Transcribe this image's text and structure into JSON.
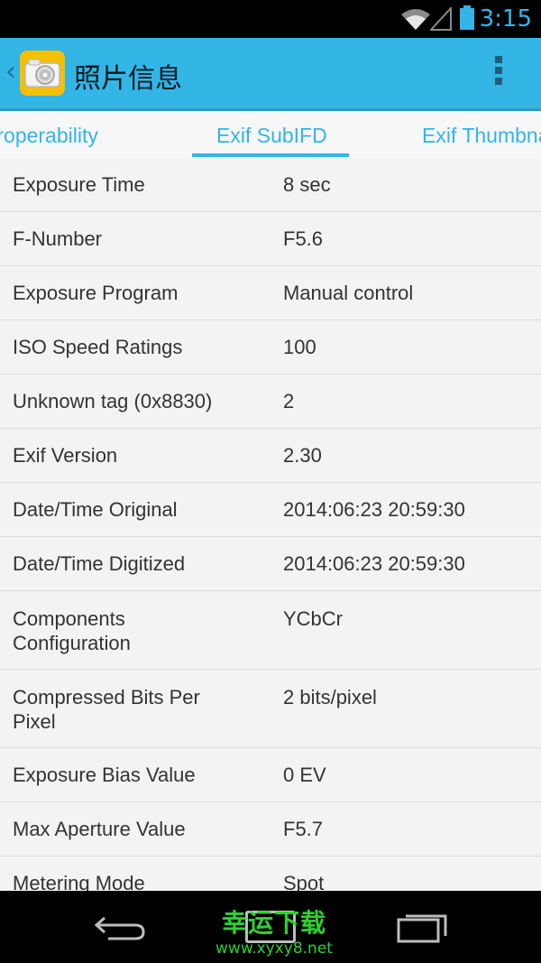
{
  "status_bar": {
    "time": "3:15"
  },
  "action_bar": {
    "title": "照片信息",
    "back_glyph": "‹"
  },
  "tabs": [
    {
      "label": "Interoperability"
    },
    {
      "label": "Exif SubIFD"
    },
    {
      "label": "Exif Thumbnail"
    }
  ],
  "rows": [
    {
      "label": "Exposure Time",
      "value": "8 sec"
    },
    {
      "label": "F-Number",
      "value": "F5.6"
    },
    {
      "label": "Exposure Program",
      "value": "Manual control"
    },
    {
      "label": "ISO Speed Ratings",
      "value": "100"
    },
    {
      "label": "Unknown tag (0x8830)",
      "value": "2"
    },
    {
      "label": "Exif Version",
      "value": "2.30"
    },
    {
      "label": "Date/Time Original",
      "value": "2014:06:23 20:59:30"
    },
    {
      "label": "Date/Time Digitized",
      "value": "2014:06:23 20:59:30"
    },
    {
      "label": "Components Configuration",
      "value": "YCbCr"
    },
    {
      "label": "Compressed Bits Per Pixel",
      "value": "2 bits/pixel"
    },
    {
      "label": "Exposure Bias Value",
      "value": "0 EV"
    },
    {
      "label": "Max Aperture Value",
      "value": "F5.7"
    },
    {
      "label": "Metering Mode",
      "value": "Spot"
    }
  ],
  "watermark": {
    "title": "幸运下载",
    "url": "www.xyxy8.net"
  },
  "colors": {
    "accent": "#33b5e5",
    "app_icon": "#f5c000",
    "watermark": "#2fcf2f"
  }
}
